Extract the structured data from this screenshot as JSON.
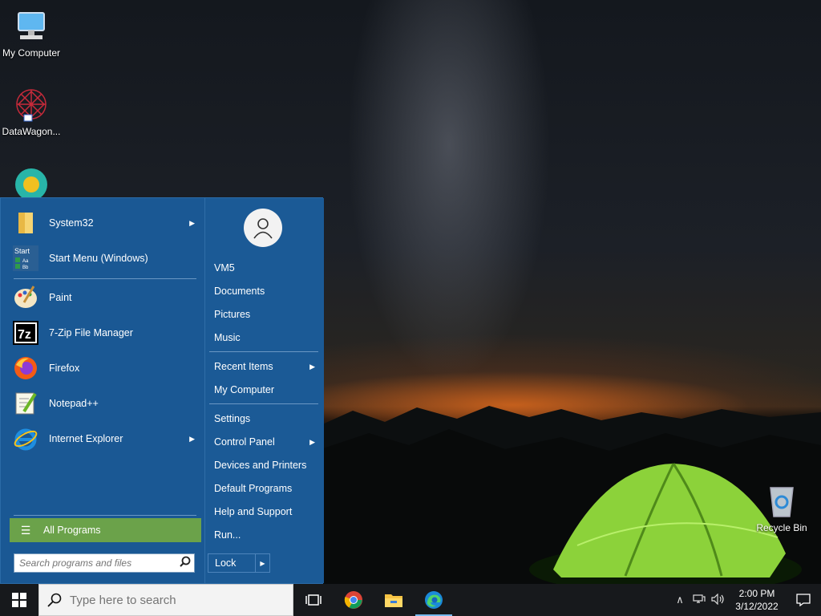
{
  "desktop": {
    "icons": [
      {
        "label": "My Computer",
        "icon": "monitor-icon"
      },
      {
        "label": "DataWagon...",
        "icon": "datawagon-icon"
      },
      {
        "label": "",
        "icon": "security-app-icon"
      },
      {
        "label": "Recycle Bin",
        "icon": "recycle-bin-icon"
      }
    ]
  },
  "start_menu": {
    "pinned": [
      {
        "label": "System32",
        "icon": "folder-icon",
        "submenu": true
      },
      {
        "label": "Start Menu (Windows)",
        "icon": "start-menu-icon",
        "submenu": false
      }
    ],
    "recent": [
      {
        "label": "Paint",
        "icon": "paint-icon",
        "submenu": false
      },
      {
        "label": "7-Zip File Manager",
        "icon": "7zip-icon",
        "submenu": false
      },
      {
        "label": "Firefox",
        "icon": "firefox-icon",
        "submenu": false
      },
      {
        "label": "Notepad++",
        "icon": "notepadpp-icon",
        "submenu": false
      },
      {
        "label": "Internet Explorer",
        "icon": "ie-icon",
        "submenu": true
      }
    ],
    "all_programs_label": "All Programs",
    "search_placeholder": "Search programs and files",
    "right_items": [
      {
        "label": "VM5",
        "submenu": false
      },
      {
        "label": "Documents",
        "submenu": false
      },
      {
        "label": "Pictures",
        "submenu": false
      },
      {
        "label": "Music",
        "submenu": false
      },
      {
        "label": "Recent Items",
        "submenu": true
      },
      {
        "label": "My Computer",
        "submenu": false
      },
      {
        "label": "Settings",
        "submenu": false
      },
      {
        "label": "Control Panel",
        "submenu": true
      },
      {
        "label": "Devices and Printers",
        "submenu": false
      },
      {
        "label": "Default Programs",
        "submenu": false
      },
      {
        "label": "Help and Support",
        "submenu": false
      },
      {
        "label": "Run...",
        "submenu": false
      }
    ],
    "lock_label": "Lock",
    "start_icon_text": [
      "Start",
      "Aa",
      "Bb"
    ]
  },
  "taskbar": {
    "search_placeholder": "Type here to search",
    "apps": [
      {
        "name": "task-view",
        "active": false
      },
      {
        "name": "chrome",
        "active": false
      },
      {
        "name": "file-explorer",
        "active": false
      },
      {
        "name": "edge",
        "active": true
      }
    ],
    "time": "2:00 PM",
    "date": "3/12/2022"
  },
  "colors": {
    "menu_bg": "#1b5a96",
    "all_programs_bg": "#6ba24a",
    "taskbar_bg": "#17191c"
  }
}
